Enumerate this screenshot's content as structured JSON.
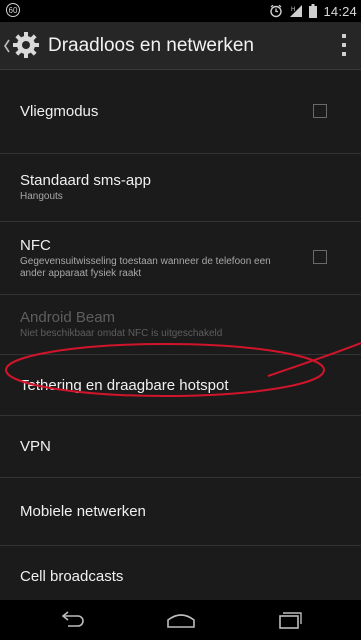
{
  "status_bar": {
    "notification_count": "60",
    "time": "14:24",
    "icons": [
      "alarm-icon",
      "signal-icon",
      "battery-icon"
    ]
  },
  "action_bar": {
    "title": "Draadloos en netwerken",
    "icon": "settings-gear-icon"
  },
  "settings": [
    {
      "title": "Vliegmodus",
      "summary": "",
      "checkbox": false,
      "enabled": true
    },
    {
      "title": "Standaard sms-app",
      "summary": "Hangouts",
      "enabled": true
    },
    {
      "title": "NFC",
      "summary": "Gegevensuitwisseling toestaan wanneer de telefoon een ander apparaat fysiek raakt",
      "checkbox": false,
      "enabled": true
    },
    {
      "title": "Android Beam",
      "summary": "Niet beschikbaar omdat NFC is uitgeschakeld",
      "enabled": false
    },
    {
      "title": "Tethering en draagbare hotspot",
      "summary": "",
      "enabled": true,
      "highlighted": true
    },
    {
      "title": "VPN",
      "summary": "",
      "enabled": true
    },
    {
      "title": "Mobiele netwerken",
      "summary": "",
      "enabled": true
    },
    {
      "title": "Cell broadcasts",
      "summary": "",
      "enabled": true
    }
  ],
  "colors": {
    "background": "#1b1b1b",
    "annotation": "#d0152b",
    "divider": "#333333"
  },
  "nav_bar": {
    "buttons": [
      "back-icon",
      "home-icon",
      "recents-icon"
    ]
  }
}
